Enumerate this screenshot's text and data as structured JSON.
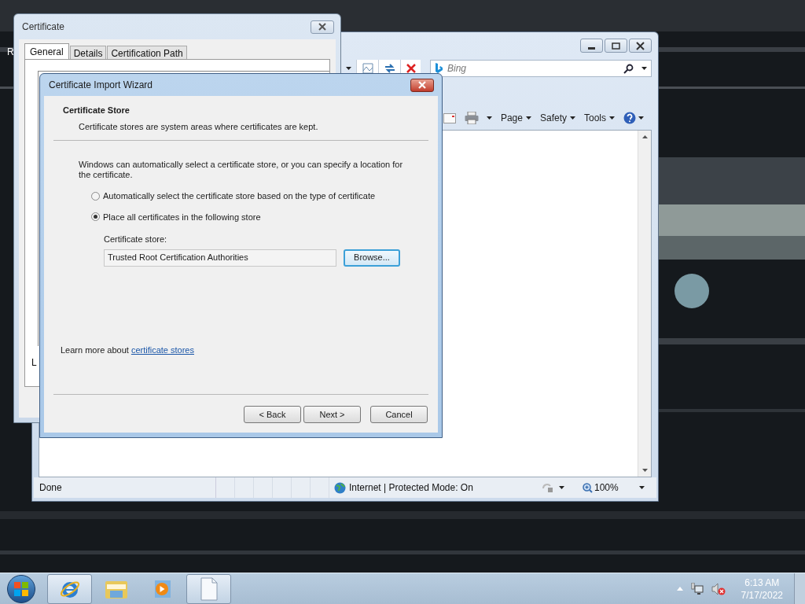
{
  "desktop": {
    "label": "R"
  },
  "browser": {
    "search": {
      "placeholder": "Bing"
    },
    "command_bar": [
      {
        "label": "Page"
      },
      {
        "label": "Safety"
      },
      {
        "label": "Tools"
      }
    ],
    "status_bar": {
      "status": "Done",
      "zone": "Internet | Protected Mode: On",
      "zoom": "100%"
    }
  },
  "certificate_window": {
    "title": "Certificate",
    "tabs": [
      {
        "label": "General",
        "selected": true
      },
      {
        "label": "Details",
        "selected": false
      },
      {
        "label": "Certification Path",
        "selected": false
      }
    ],
    "partial_text": "L"
  },
  "wizard": {
    "title": "Certificate Import Wizard",
    "header": {
      "title": "Certificate Store",
      "subtitle": "Certificate stores are system areas where certificates are kept."
    },
    "intro": "Windows can automatically select a certificate store, or you can specify a location for the certificate.",
    "options": [
      {
        "label": "Automatically select the certificate store based on the type of certificate",
        "selected": false
      },
      {
        "label": "Place all certificates in the following store",
        "selected": true
      }
    ],
    "store": {
      "label": "Certificate store:",
      "value": "Trusted Root Certification Authorities"
    },
    "browse_button": "Browse...",
    "learn_more": {
      "text": "Learn more about",
      "link": "certificate stores"
    },
    "buttons": [
      "< Back",
      "Next >",
      "Cancel"
    ]
  },
  "taskbar": {
    "items": [
      {
        "kind": "browser",
        "running": true
      },
      {
        "kind": "folder",
        "running": false
      },
      {
        "kind": "media",
        "running": false
      },
      {
        "kind": "document",
        "running": true
      }
    ],
    "clock": {
      "time": "6:13 AM",
      "date": "7/17/2022"
    }
  }
}
